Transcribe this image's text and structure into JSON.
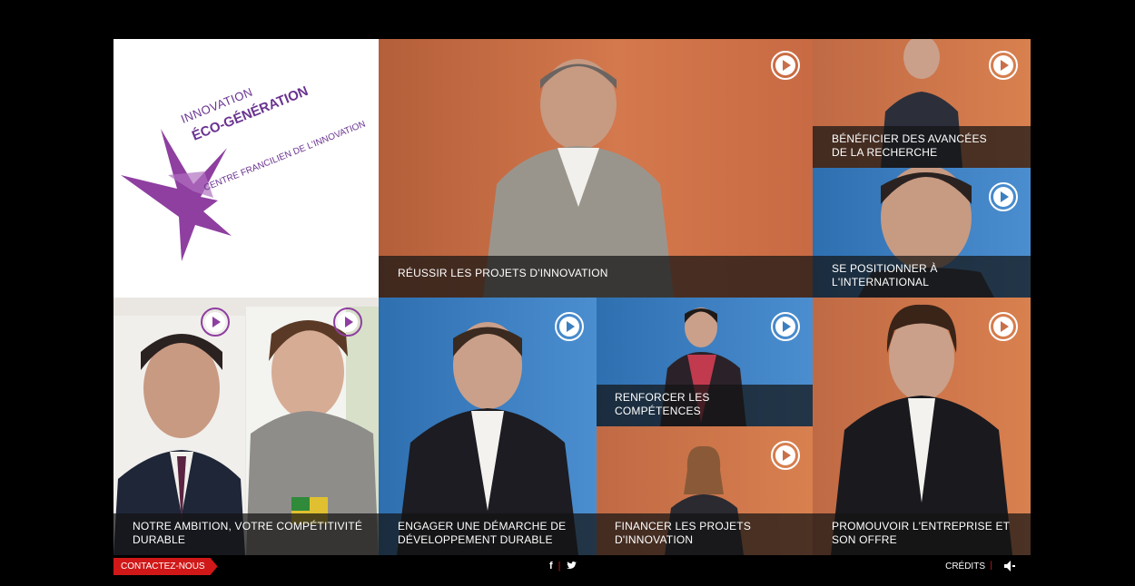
{
  "logo": {
    "line1": "INNOVATION",
    "line2": "ÉCO-GÉNÉRATION",
    "line3": "CENTRE FRANCILIEN DE L'INNOVATION"
  },
  "tiles": {
    "reussir": {
      "caption": [
        "RÉUSSIR LES PROJETS D'INNOVATION"
      ]
    },
    "beneficier": {
      "caption": [
        "BÉNÉFICIER DES AVANCÉES",
        "DE LA RECHERCHE"
      ]
    },
    "positionner": {
      "caption": [
        "SE POSITIONNER À",
        "L'INTERNATIONAL"
      ]
    },
    "ambition": {
      "caption": [
        "NOTRE AMBITION, VOTRE COMPÉTITIVITÉ",
        "DURABLE"
      ]
    },
    "engager": {
      "caption": [
        "ENGAGER UNE DÉMARCHE DE",
        "DÉVELOPPEMENT DURABLE"
      ]
    },
    "renforcer": {
      "caption": [
        "RENFORCER LES",
        "COMPÉTENCES"
      ]
    },
    "financer": {
      "caption": [
        "FINANCER LES PROJETS",
        "D'INNOVATION"
      ]
    },
    "promouvoir": {
      "caption": [
        "PROMOUVOIR L'ENTREPRISE ET",
        "SON OFFRE"
      ]
    }
  },
  "footer": {
    "contact_label": "CONTACTEZ-NOUS",
    "facebook": "f",
    "twitter_icon": "twitter-icon",
    "credits_label": "CRÉDITS",
    "sound_icon": "speaker-icon"
  },
  "colors": {
    "orange_bg": "#c8704a",
    "blue_bg": "#3b7fc0",
    "purple_brand": "#8e3fa0",
    "red_accent": "#d01818"
  }
}
